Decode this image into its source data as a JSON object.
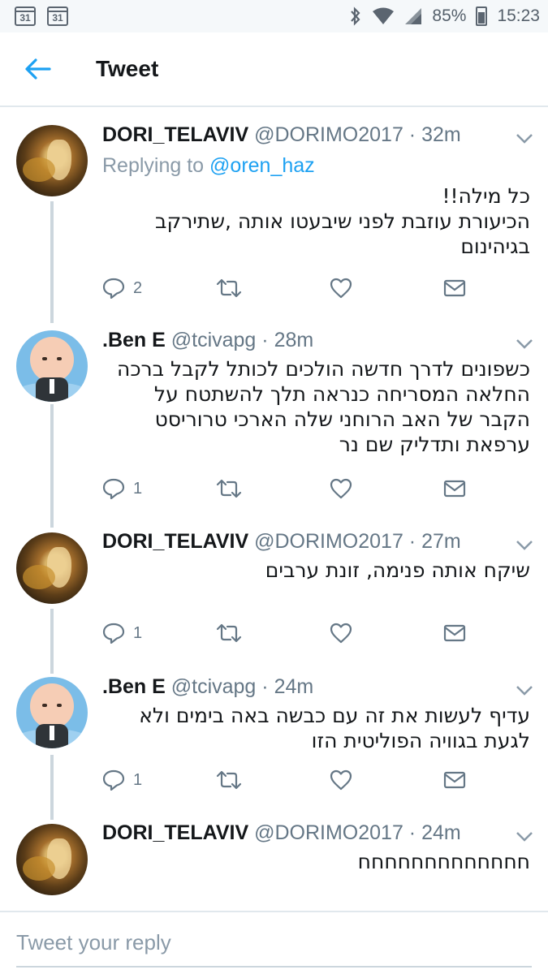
{
  "status_bar": {
    "calendar_1": "31",
    "calendar_2": "31",
    "battery": "85%",
    "time": "15:23",
    "icons": [
      "bluetooth-icon",
      "wifi-icon",
      "signal-icon",
      "battery-icon"
    ]
  },
  "header": {
    "title": "Tweet",
    "back_icon": "back-arrow-icon"
  },
  "tweets": [
    {
      "name": "DORI_TELAVIV",
      "handle": "@DORIMO2017",
      "time": "32m",
      "replying_prefix": "Replying to",
      "replying_to": "@oren_haz",
      "text_lines": [
        "כל מילה!!",
        "הכיעורת עוזבת לפני שיבעטו אותה ,שתירקב",
        "בגיהינום"
      ],
      "reply_count": "2",
      "avatar": "dori-avatar"
    },
    {
      "name": ".Ben E",
      "handle": "@tcivapg",
      "time": "28m",
      "text_lines": [
        "כשפונים לדרך חדשה הולכים לכותל לקבל ברכה",
        "החלאה המסריחה כנראה תלך להשתטח על",
        "הקבר של האב הרוחני שלה הארכי טרוריסט",
        "ערפאת ותדליק שם נר"
      ],
      "reply_count": "1",
      "avatar": "ben-avatar"
    },
    {
      "name": "DORI_TELAVIV",
      "handle": "@DORIMO2017",
      "time": "27m",
      "text_lines": [
        "שיקח אותה פנימה, זונת ערבים"
      ],
      "reply_count": "1",
      "avatar": "dori-avatar"
    },
    {
      "name": ".Ben E",
      "handle": "@tcivapg",
      "time": "24m",
      "text_lines": [
        "עדיף לעשות את זה עם כבשה באה בימים ולא",
        "לגעת בגוויה הפוליטית הזו"
      ],
      "reply_count": "1",
      "avatar": "ben-avatar"
    },
    {
      "name": "DORI_TELAVIV",
      "handle": "@DORIMO2017",
      "time": "24m",
      "text_lines": [
        "חחחחחחחחחחחחח"
      ],
      "avatar": "dori-avatar"
    }
  ],
  "reply_bar": {
    "placeholder": "Tweet your reply"
  },
  "colors": {
    "accent": "#1da1f2",
    "muted": "#657786",
    "divider": "#e1e8ed"
  }
}
